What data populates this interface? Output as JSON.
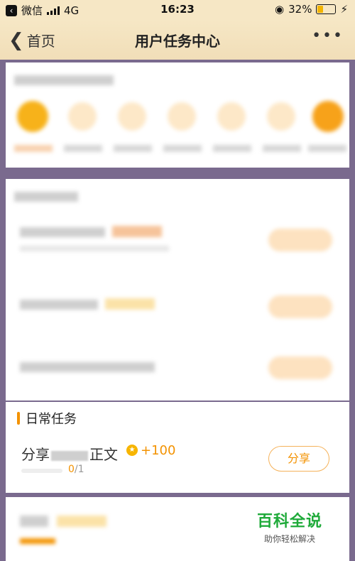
{
  "status_bar": {
    "back_app": "微信",
    "network": "4G",
    "time": "16:23",
    "battery_percent": "32%",
    "battery_level": 0.32
  },
  "navbar": {
    "back_label": "首页",
    "title": "用户任务中心",
    "more": "•••"
  },
  "daily_tasks": {
    "heading": "日常任务",
    "task": {
      "name_prefix": "分享",
      "name_suffix": "正文",
      "reward": "+100",
      "progress_current": "0",
      "progress_total": "/1",
      "button_label": "分享"
    }
  },
  "watermark": {
    "title": "百科全说",
    "subtitle": "助你轻松解决"
  },
  "colors": {
    "accent": "#f39200",
    "nav_bg": "#f6e7c5",
    "watermark_green": "#1faa3a"
  }
}
